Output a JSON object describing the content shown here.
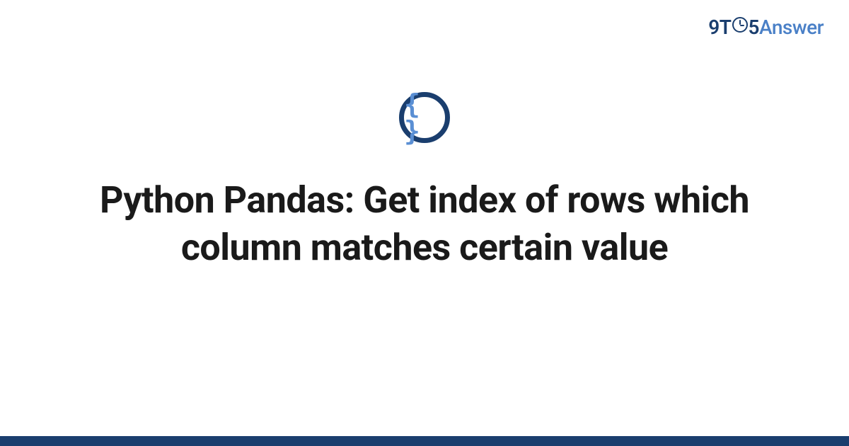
{
  "logo": {
    "part1": "9T",
    "part2": "5",
    "part3": "Answer"
  },
  "icon": {
    "name": "code-braces-icon",
    "glyph": "{ }"
  },
  "title": "Python Pandas: Get index of rows which column matches certain value",
  "colors": {
    "primary": "#1a3e6e",
    "accent": "#4a80c7"
  }
}
